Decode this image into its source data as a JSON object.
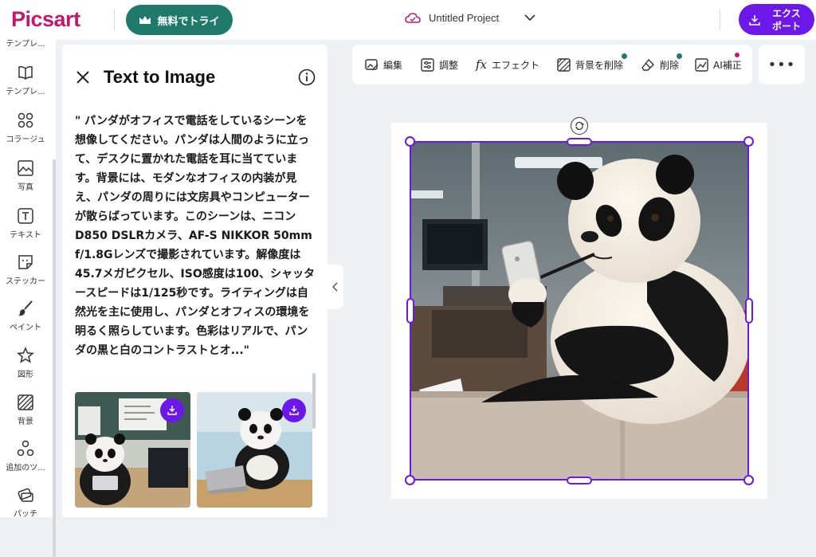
{
  "app": {
    "logo": "Picsart",
    "try_button": "無料でトライ",
    "project_title": "Untitled Project",
    "export_label": "エクスポート"
  },
  "nav": {
    "items": [
      {
        "label": "テンプレ..."
      },
      {
        "label": "コラージュ"
      },
      {
        "label": "写真"
      },
      {
        "label": "テキスト"
      },
      {
        "label": "ステッカー"
      },
      {
        "label": "ペイント"
      },
      {
        "label": "図形"
      },
      {
        "label": "背景"
      },
      {
        "label": "追加のツ..."
      },
      {
        "label": "パッチ"
      }
    ]
  },
  "panel": {
    "title": "Text to Image",
    "prompt": "\" パンダがオフィスで電話をしているシーンを想像してください。パンダは人間のように立って、デスクに置かれた電話を耳に当てています。背景には、モダンなオフィスの内装が見え、パンダの周りには文房具やコンピューターが散らばっています。このシーンは、ニコンD850 DSLRカメラ、AF-S NIKKOR 50mm f/1.8Gレンズで撮影されています。解像度は45.7メガピクセル、ISO感度は100、シャッタースピードは1/125秒です。ライティングは自然光を主に使用し、パンダとオフィスの環境を明るく照らしています。色彩はリアルで、パンダの黒と白のコントラストとオ...\""
  },
  "toolbar": {
    "edit": "編集",
    "adjust": "調整",
    "effect": "エフェクト",
    "remove_bg": "背景を削除",
    "erase": "削除",
    "ai_enhance": "AI補正"
  },
  "colors": {
    "brand": "#c2186d",
    "accent": "#6b18e8",
    "teal": "#1f7a6c"
  }
}
